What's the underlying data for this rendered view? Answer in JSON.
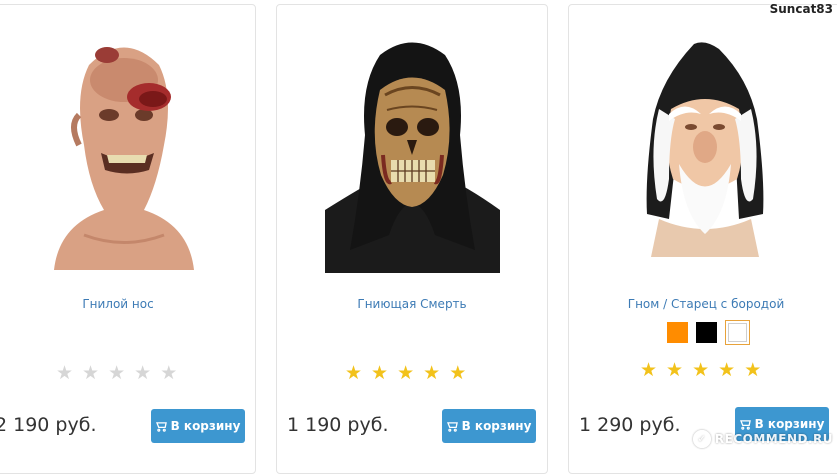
{
  "products": [
    {
      "title": "Гнилой нос",
      "price": "2 190 руб.",
      "rating": 0,
      "cart_label": "В корзину",
      "image": "rotten-nose-mask-image"
    },
    {
      "title": "Гниющая Смерть",
      "price": "1 190 руб.",
      "rating": 5,
      "cart_label": "В корзину",
      "image": "rotting-death-mask-image"
    },
    {
      "title": "Гном / Старец с бородой",
      "price": "1 290 руб.",
      "rating": 5,
      "cart_label": "В корзину",
      "image": "gnome-old-man-mask-image",
      "color_options": [
        "#ff8c00",
        "#000000",
        "#ffffff"
      ],
      "selected_color_index": 2
    }
  ],
  "colors": {
    "star_filled": "#f2c21b",
    "star_empty": "#d6d6d6",
    "link": "#3d7bb5",
    "button": "#3d97d0"
  },
  "watermark": {
    "user": "Suncat83",
    "site": "RECOMMEND.RU"
  }
}
